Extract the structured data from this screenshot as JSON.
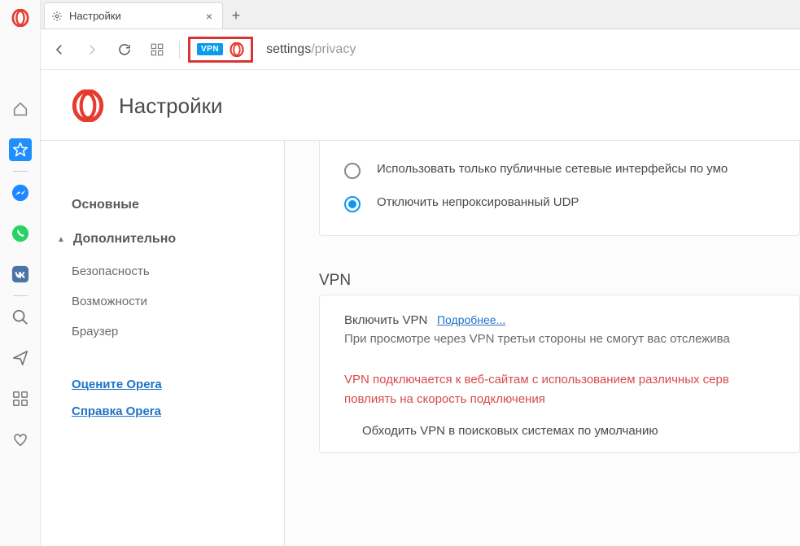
{
  "rail": {
    "icons": [
      "opera-logo",
      "home",
      "bookmark",
      "messenger",
      "whatsapp",
      "vk",
      "search",
      "send",
      "apps",
      "heart"
    ]
  },
  "tab": {
    "title": "Настройки"
  },
  "toolbar": {
    "vpn_label": "VPN",
    "url_prefix": "settings",
    "url_suffix": "/privacy"
  },
  "page": {
    "title": "Настройки"
  },
  "sidebar": {
    "main": "Основные",
    "advanced": "Дополнительно",
    "items": [
      "Безопасность",
      "Возможности",
      "Браузер"
    ],
    "links": [
      "Оцените Opera",
      "Справка Opera"
    ]
  },
  "settings": {
    "radio1": "Использовать только публичные сетевые интерфейсы по умо",
    "radio2": "Отключить непроксированный UDP",
    "vpn_section": "VPN",
    "enable_vpn": "Включить VPN",
    "learn_more": "Подробнее...",
    "vpn_desc": "При просмотре через VPN третьи стороны не смогут вас отслежива",
    "warning": "VPN подключается к веб-сайтам с использованием различных серв",
    "warning2": "повлиять на скорость подключения",
    "bypass": "Обходить VPN в поисковых системах по умолчанию"
  }
}
